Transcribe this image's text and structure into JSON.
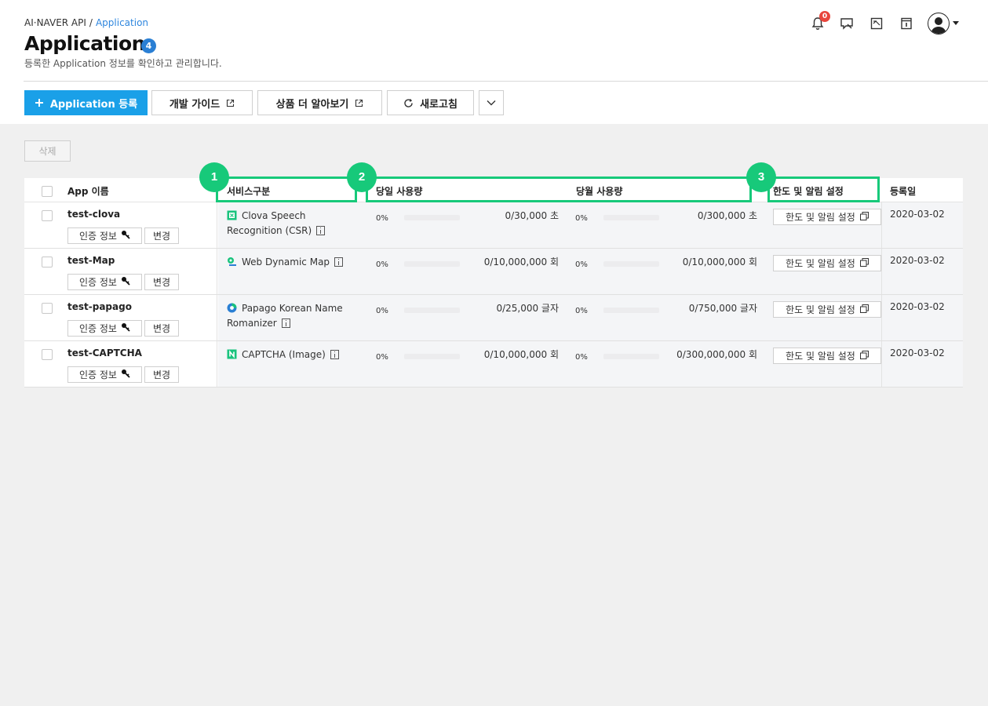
{
  "breadcrumb": {
    "root": "AI·NAVER API",
    "separator": "/",
    "current": "Application"
  },
  "page": {
    "title": "Application",
    "count": "4",
    "description": "등록한 Application 정보를 확인하고 관리합니다."
  },
  "header_icons": {
    "notification_count": "0",
    "icons": [
      "bell-icon",
      "chat-icon",
      "memo-icon",
      "document-icon",
      "user-avatar"
    ]
  },
  "toolbar": {
    "register_label": "Application 등록",
    "dev_guide_label": "개발 가이드",
    "product_more_label": "상품 더 알아보기",
    "refresh_label": "새로고침"
  },
  "delete_label": "삭제",
  "table": {
    "headers": {
      "app_name": "App 이름",
      "service": "서비스구분",
      "daily_usage": "당일 사용량",
      "monthly_usage": "당월 사용량",
      "limit_settings": "한도 및 알림 설정",
      "reg_date": "등록일"
    },
    "auth_info_label": "인증 정보",
    "change_label": "변경",
    "limit_button_label": "한도 및 알림 설정",
    "rows": [
      {
        "app_name": "test-clova",
        "service_line1": "Clova Speech",
        "service_line2": "Recognition (CSR)",
        "service_icon": "clova-speech-icon",
        "daily_pct": "0%",
        "daily_fill": 0,
        "daily_usage": "0/30,000 초",
        "monthly_pct": "0%",
        "monthly_fill": 0,
        "monthly_usage": "0/300,000 초",
        "reg_date": "2020-03-02"
      },
      {
        "app_name": "test-Map",
        "service_line1": "Web Dynamic Map",
        "service_line2": "",
        "service_icon": "map-icon",
        "daily_pct": "0%",
        "daily_fill": 0,
        "daily_usage": "0/10,000,000 회",
        "monthly_pct": "0%",
        "monthly_fill": 0,
        "monthly_usage": "0/10,000,000 회",
        "reg_date": "2020-03-02"
      },
      {
        "app_name": "test-papago",
        "service_line1": "Papago Korean Name",
        "service_line2": "Romanizer",
        "service_icon": "papago-icon",
        "daily_pct": "0%",
        "daily_fill": 0,
        "daily_usage": "0/25,000 글자",
        "monthly_pct": "0%",
        "monthly_fill": 0,
        "monthly_usage": "0/750,000 글자",
        "reg_date": "2020-03-02"
      },
      {
        "app_name": "test-CAPTCHA",
        "service_line1": "CAPTCHA (Image)",
        "service_line2": "",
        "service_icon": "captcha-icon",
        "daily_pct": "0%",
        "daily_fill": 0,
        "daily_usage": "0/10,000,000 회",
        "monthly_pct": "0%",
        "monthly_fill": 0,
        "monthly_usage": "0/300,000,000 회",
        "reg_date": "2020-03-02"
      }
    ]
  },
  "annotations": [
    "1",
    "2",
    "3"
  ],
  "colors": {
    "primary": "#1aa0e8",
    "highlight": "#17c97a",
    "badge_blue": "#2a7fd4",
    "notification_red": "#e8453c"
  }
}
